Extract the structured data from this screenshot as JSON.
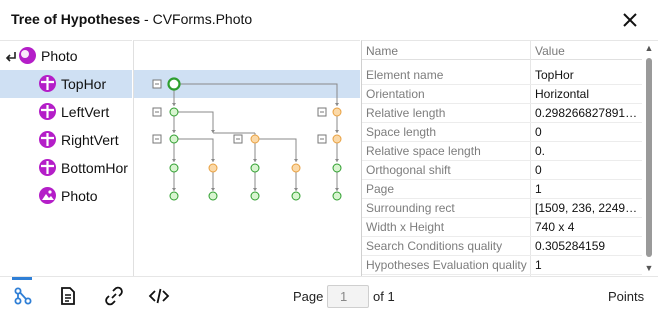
{
  "window": {
    "title_bold": "Tree of Hypotheses",
    "title_rest": " - CVForms.Photo",
    "close_icon": "close-icon"
  },
  "tree": {
    "root": {
      "label": "Photo",
      "icon": "photo-root-icon"
    },
    "items": [
      {
        "label": "TopHor",
        "icon": "split-horizontal-icon",
        "selected": true
      },
      {
        "label": "LeftVert",
        "icon": "split-horizontal-icon",
        "selected": false
      },
      {
        "label": "RightVert",
        "icon": "split-horizontal-icon",
        "selected": false
      },
      {
        "label": "BottomHor",
        "icon": "split-horizontal-icon",
        "selected": false
      },
      {
        "label": "Photo",
        "icon": "photo-icon",
        "selected": false
      }
    ]
  },
  "properties": {
    "header_name": "Name",
    "header_value": "Value",
    "rows": [
      {
        "name": "Element name",
        "value": "TopHor"
      },
      {
        "name": "Orientation",
        "value": "Horizontal"
      },
      {
        "name": "Relative length",
        "value": "0.29826682789197..."
      },
      {
        "name": "Space length",
        "value": "0"
      },
      {
        "name": "Relative space length",
        "value": "0."
      },
      {
        "name": "Orthogonal shift",
        "value": "0"
      },
      {
        "name": "Page",
        "value": "1"
      },
      {
        "name": "Surrounding rect",
        "value": "[1509, 236, 2249, 2..."
      },
      {
        "name": "Width x Height",
        "value": "740 x 4"
      },
      {
        "name": "Search Conditions quality",
        "value": "0.305284159"
      },
      {
        "name": "Hypotheses Evaluation quality",
        "value": "1"
      }
    ]
  },
  "toolbar": {
    "buttons": [
      "tree-icon",
      "document-icon",
      "link-icon",
      "code-icon"
    ],
    "page_label": "Page",
    "page_value": "1",
    "of_label": "of 1",
    "points_label": "Points"
  },
  "colors": {
    "accent": "#2f7fd6",
    "selection": "#cfe0f3",
    "node_icon": "#b41ec8",
    "graph_node_green": "#2e9e2e",
    "graph_node_orange": "#f0a040",
    "graph_edge": "#888888"
  }
}
